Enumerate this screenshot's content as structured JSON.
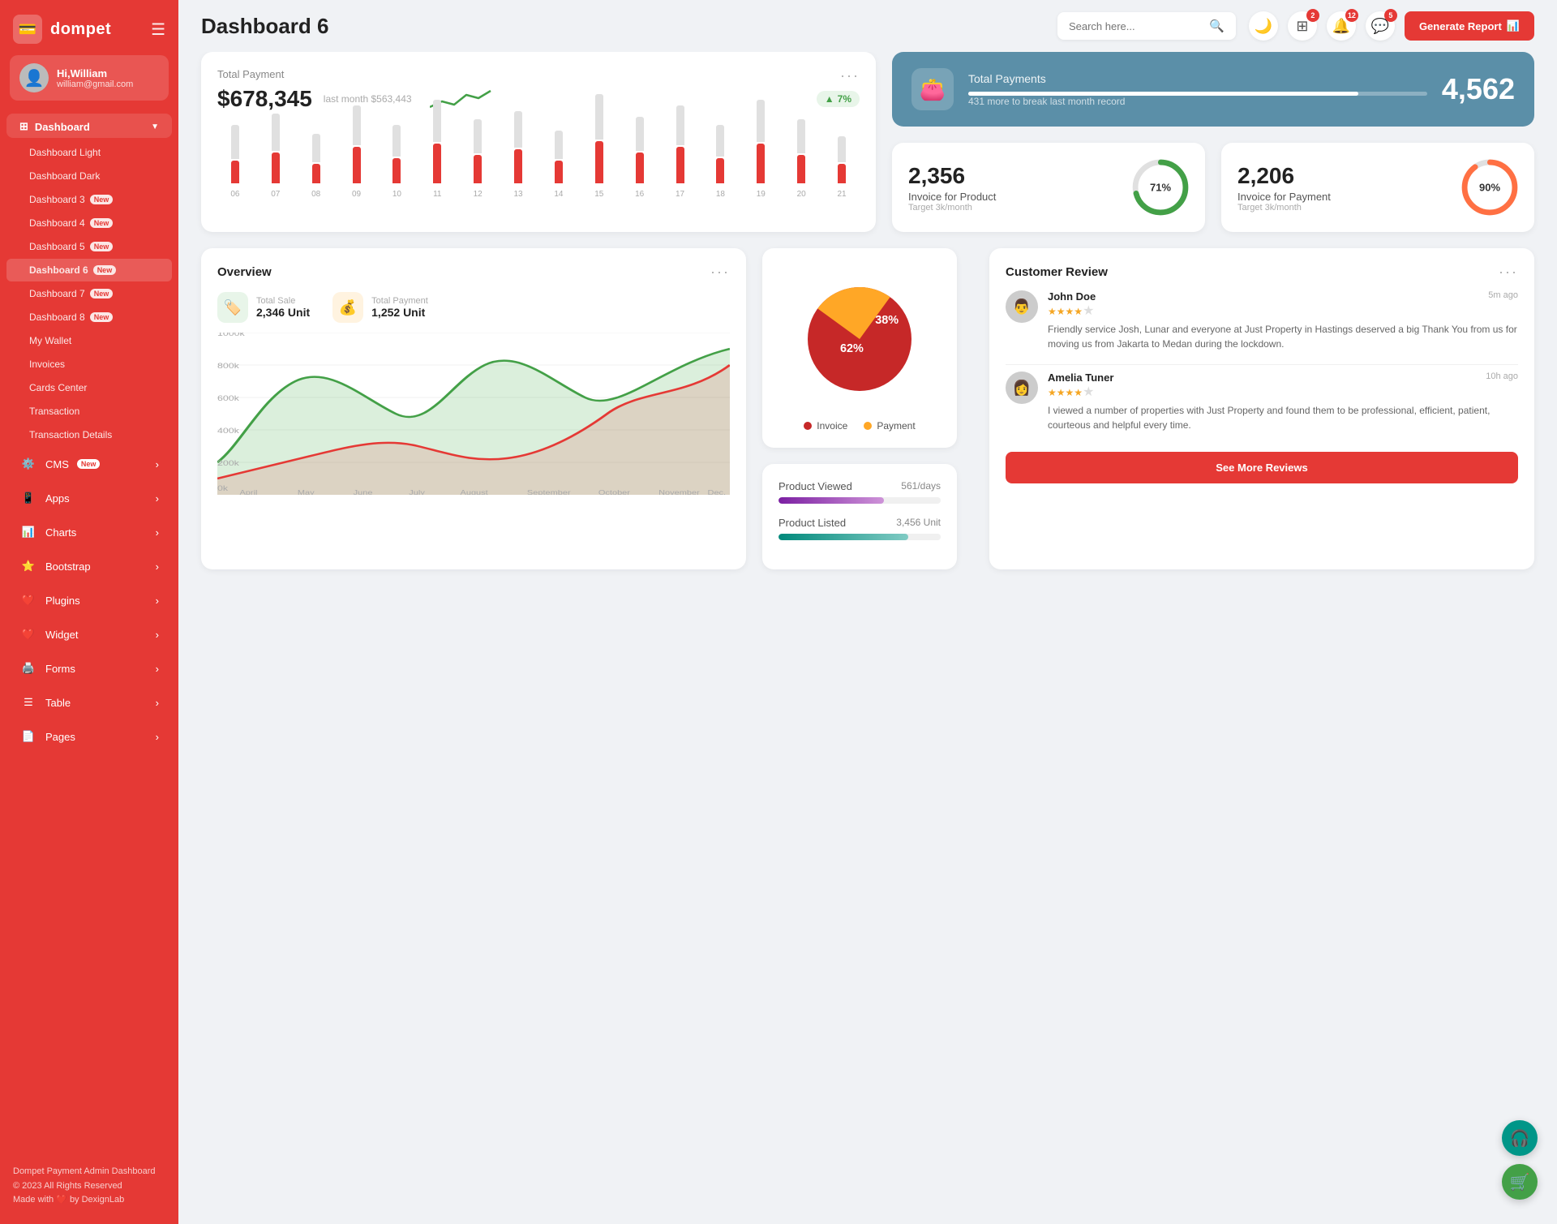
{
  "sidebar": {
    "logo": "dompet",
    "logo_icon": "💳",
    "hamburger": "☰",
    "user": {
      "name": "Hi,William",
      "email": "william@gmail.com",
      "avatar": "👤"
    },
    "dashboard_label": "Dashboard",
    "dashboard_items": [
      {
        "label": "Dashboard Light",
        "active": false,
        "badge": ""
      },
      {
        "label": "Dashboard Dark",
        "active": false,
        "badge": ""
      },
      {
        "label": "Dashboard 3",
        "active": false,
        "badge": "New"
      },
      {
        "label": "Dashboard 4",
        "active": false,
        "badge": "New"
      },
      {
        "label": "Dashboard 5",
        "active": false,
        "badge": "New"
      },
      {
        "label": "Dashboard 6",
        "active": true,
        "badge": "New"
      },
      {
        "label": "Dashboard 7",
        "active": false,
        "badge": "New"
      },
      {
        "label": "Dashboard 8",
        "active": false,
        "badge": "New"
      },
      {
        "label": "My Wallet",
        "active": false,
        "badge": ""
      },
      {
        "label": "Invoices",
        "active": false,
        "badge": ""
      },
      {
        "label": "Cards Center",
        "active": false,
        "badge": ""
      },
      {
        "label": "Transaction",
        "active": false,
        "badge": ""
      },
      {
        "label": "Transaction Details",
        "active": false,
        "badge": ""
      }
    ],
    "main_nav": [
      {
        "label": "CMS",
        "badge": "New",
        "icon": "⚙️"
      },
      {
        "label": "Apps",
        "badge": "",
        "icon": "📱"
      },
      {
        "label": "Charts",
        "badge": "",
        "icon": "📊"
      },
      {
        "label": "Bootstrap",
        "badge": "",
        "icon": "⭐"
      },
      {
        "label": "Plugins",
        "badge": "",
        "icon": "❤️"
      },
      {
        "label": "Widget",
        "badge": "",
        "icon": "❤️"
      },
      {
        "label": "Forms",
        "badge": "",
        "icon": "🖨️"
      },
      {
        "label": "Table",
        "badge": "",
        "icon": "☰"
      },
      {
        "label": "Pages",
        "badge": "",
        "icon": "📄"
      }
    ],
    "footer_line1": "Dompet Payment Admin Dashboard",
    "footer_line2": "© 2023 All Rights Reserved",
    "footer_line3": "Made with ❤️ by DexignLab"
  },
  "topbar": {
    "title": "Dashboard 6",
    "search_placeholder": "Search here...",
    "badges": {
      "apps": "2",
      "notifications": "12",
      "messages": "5"
    },
    "generate_btn": "Generate Report"
  },
  "total_payment": {
    "label": "Total Payment",
    "amount": "$678,345",
    "last_month": "last month $563,443",
    "growth": "7%",
    "bars": [
      {
        "red": 40,
        "gray": 60
      },
      {
        "red": 55,
        "gray": 65
      },
      {
        "red": 35,
        "gray": 50
      },
      {
        "red": 65,
        "gray": 70
      },
      {
        "red": 45,
        "gray": 55
      },
      {
        "red": 70,
        "gray": 75
      },
      {
        "red": 50,
        "gray": 60
      },
      {
        "red": 60,
        "gray": 65
      },
      {
        "red": 40,
        "gray": 50
      },
      {
        "red": 75,
        "gray": 80
      },
      {
        "red": 55,
        "gray": 60
      },
      {
        "red": 65,
        "gray": 70
      },
      {
        "red": 45,
        "gray": 55
      },
      {
        "red": 70,
        "gray": 75
      },
      {
        "red": 50,
        "gray": 60
      },
      {
        "red": 35,
        "gray": 45
      }
    ],
    "bar_labels": [
      "06",
      "07",
      "08",
      "09",
      "10",
      "11",
      "12",
      "13",
      "14",
      "15",
      "16",
      "17",
      "18",
      "19",
      "20",
      "21"
    ]
  },
  "total_payments_blue": {
    "label": "Total Payments",
    "sub": "431 more to break last month record",
    "number": "4,562"
  },
  "invoice_product": {
    "number": "2,356",
    "label": "Invoice for Product",
    "target": "Target 3k/month",
    "pct": "71%",
    "pct_num": 71
  },
  "invoice_payment": {
    "number": "2,206",
    "label": "Invoice for Payment",
    "target": "Target 3k/month",
    "pct": "90%",
    "pct_num": 90
  },
  "overview": {
    "title": "Overview",
    "total_sale_label": "Total Sale",
    "total_sale_value": "2,346 Unit",
    "total_payment_label": "Total Payment",
    "total_payment_value": "1,252 Unit",
    "y_labels": [
      "1000k",
      "800k",
      "600k",
      "400k",
      "200k",
      "0k"
    ],
    "x_labels": [
      "April",
      "May",
      "June",
      "July",
      "August",
      "September",
      "October",
      "November",
      "Dec."
    ]
  },
  "pie_chart": {
    "invoice_pct": "62%",
    "payment_pct": "38%",
    "invoice_label": "Invoice",
    "payment_label": "Payment"
  },
  "product_stats": {
    "viewed_label": "Product Viewed",
    "viewed_value": "561/days",
    "listed_label": "Product Listed",
    "listed_value": "3,456 Unit"
  },
  "customer_review": {
    "title": "Customer Review",
    "reviews": [
      {
        "name": "John Doe",
        "time": "5m ago",
        "stars": 4,
        "text": "Friendly service Josh, Lunar and everyone at Just Property in Hastings deserved a big Thank You from us for moving us from Jakarta to Medan during the lockdown.",
        "avatar": "👨"
      },
      {
        "name": "Amelia Tuner",
        "time": "10h ago",
        "stars": 4,
        "text": "I viewed a number of properties with Just Property and found them to be professional, efficient, patient, courteous and helpful every time.",
        "avatar": "👩"
      }
    ],
    "see_more_label": "See More Reviews"
  },
  "floating": {
    "headset": "🎧",
    "cart": "🛒"
  }
}
